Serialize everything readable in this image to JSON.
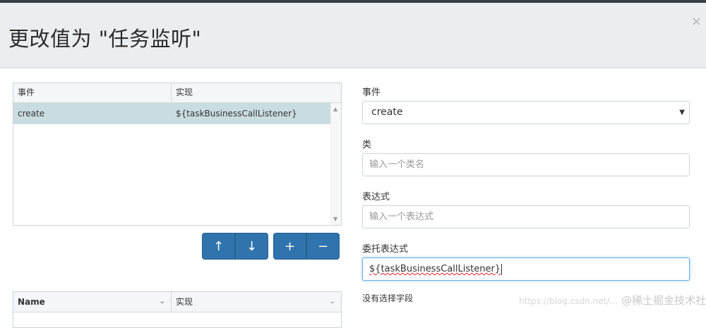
{
  "dialog": {
    "title": "更改值为 \"任务监听\"",
    "close": "×"
  },
  "listener_table": {
    "columns": [
      "事件",
      "实现"
    ],
    "rows": [
      {
        "event": "create",
        "implementation": "${taskBusinessCallListener}"
      }
    ]
  },
  "buttons": {
    "move_up": "↑",
    "move_down": "↓",
    "add": "+",
    "remove": "−"
  },
  "fields_table": {
    "columns": [
      "Name",
      "实现"
    ]
  },
  "form": {
    "event_label": "事件",
    "event_value": "create",
    "class_label": "类",
    "class_placeholder": "输入一个类名",
    "expression_label": "表达式",
    "expression_placeholder": "输入一个表达式",
    "delegate_label": "委托表达式",
    "delegate_value": "${taskBusinessCallListener}",
    "no_field_selected": "没有选择字段"
  },
  "watermark": {
    "url": "https://blog.csdn.net/…",
    "brand": "@稀土掘金技术社区"
  }
}
